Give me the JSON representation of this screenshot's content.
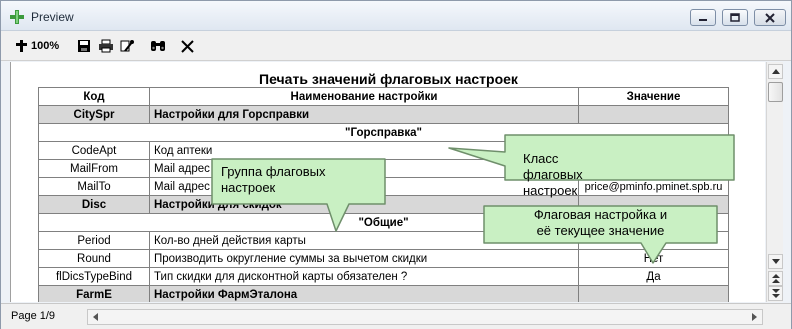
{
  "window": {
    "title": "Preview"
  },
  "toolbar": {
    "zoom_label": "100%"
  },
  "report": {
    "title": "Печать значений флаговых настроек",
    "headers": {
      "code": "Код",
      "name": "Наименование настройки",
      "value": "Значение"
    },
    "rows": [
      {
        "code": "CitySpr",
        "name": "Настройки для Горсправки",
        "value": ""
      },
      {
        "class_label": "\"Горсправка\""
      },
      {
        "code": "CodeApt",
        "name": "Код аптеки",
        "value": ""
      },
      {
        "code": "MailFrom",
        "name": "Mail адрес",
        "value": ""
      },
      {
        "code": "MailTo",
        "name": "Mail адрес",
        "value": "price@pminfo.pminet.spb.ru"
      },
      {
        "code": "Disc",
        "name": "Настройки для скидок",
        "value": ""
      },
      {
        "class_label": "\"Общие\""
      },
      {
        "code": "Period",
        "name": "Кол-во дней действия карты",
        "value": ""
      },
      {
        "code": "Round",
        "name": "Производить округление суммы за вычетом скидки",
        "value": "Нет"
      },
      {
        "code": "flDicsTypeBind",
        "name": "Тип скидки для дисконтной карты обязателен ?",
        "value": "Да"
      },
      {
        "code": "FarmE",
        "name": "Настройки ФармЭталона",
        "value": ""
      }
    ]
  },
  "callouts": {
    "group": "Группа флаговых настроек",
    "class": "Класс флаговых настроек",
    "flag_line1": "Флаговая настройка и",
    "flag_line2": "её текущее значение"
  },
  "statusbar": {
    "page_label": "Page 1/9"
  },
  "colors": {
    "callout_fill": "#c9f0c3",
    "group_row": "#d8d8d8",
    "titlebar": "#e3eaf3"
  }
}
